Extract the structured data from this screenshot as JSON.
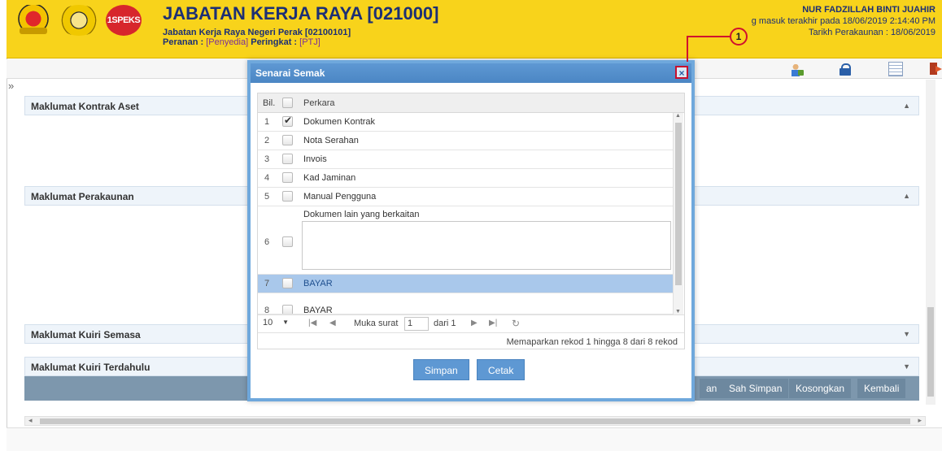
{
  "header": {
    "agency_title": "JABATAN KERJA RAYA [021000]",
    "agency_sub": "Jabatan Kerja Raya Negeri Perak [02100101]",
    "role_label": "Peranan : ",
    "role_value": "[Penyedia]",
    "level_label": " Peringkat : ",
    "level_value": "[PTJ]",
    "spek_logo": "1SPEKS",
    "user_name": "NUR FADZILLAH BINTI JUAHIR",
    "last_login": "g masuk terakhir pada 18/06/2019 2:14:40 PM",
    "account_date": "Tarikh Perakaunan : 18/06/2019",
    "brand_color": "#f8d31b"
  },
  "toolbar": {
    "icons": [
      "user-icon",
      "lock-icon",
      "list-icon",
      "exit-icon"
    ]
  },
  "sidebar": {
    "collapse_label": "»"
  },
  "sections": {
    "kontrak": "Maklumat Kontrak Aset",
    "perakaunan": "Maklumat Perakaunan",
    "kuiri_semasa": "Maklumat Kuiri Semasa",
    "kuiri_terdahulu": "Maklumat Kuiri Terdahulu"
  },
  "action_bar": {
    "partial_label": "an",
    "sah_simpan": "Sah Simpan",
    "kosongkan": "Kosongkan",
    "kembali": "Kembali"
  },
  "modal": {
    "title": "Senarai Semak",
    "close": "×",
    "col_bil": "Bil.",
    "col_perkara": "Perkara",
    "rows": [
      {
        "num": "1",
        "label": "Dokumen Kontrak",
        "checked": true
      },
      {
        "num": "2",
        "label": "Nota Serahan",
        "checked": false
      },
      {
        "num": "3",
        "label": "Invois",
        "checked": false
      },
      {
        "num": "4",
        "label": "Kad Jaminan",
        "checked": false
      },
      {
        "num": "5",
        "label": "Manual Pengguna",
        "checked": false
      },
      {
        "num": "6",
        "label": "Dokumen lain yang berkaitan",
        "checked": false
      },
      {
        "num": "7",
        "label": "BAYAR",
        "checked": false
      },
      {
        "num": "8",
        "label": "BAYAR",
        "checked": false
      }
    ],
    "pager": {
      "page_size": "10",
      "page_label": "Muka surat",
      "page_value": "1",
      "of_label": "dari 1",
      "info": "Memaparkan rekod 1 hingga 8 dari 8 rekod"
    },
    "simpan": "Simpan",
    "cetak": "Cetak"
  },
  "callout": {
    "number": "1"
  }
}
